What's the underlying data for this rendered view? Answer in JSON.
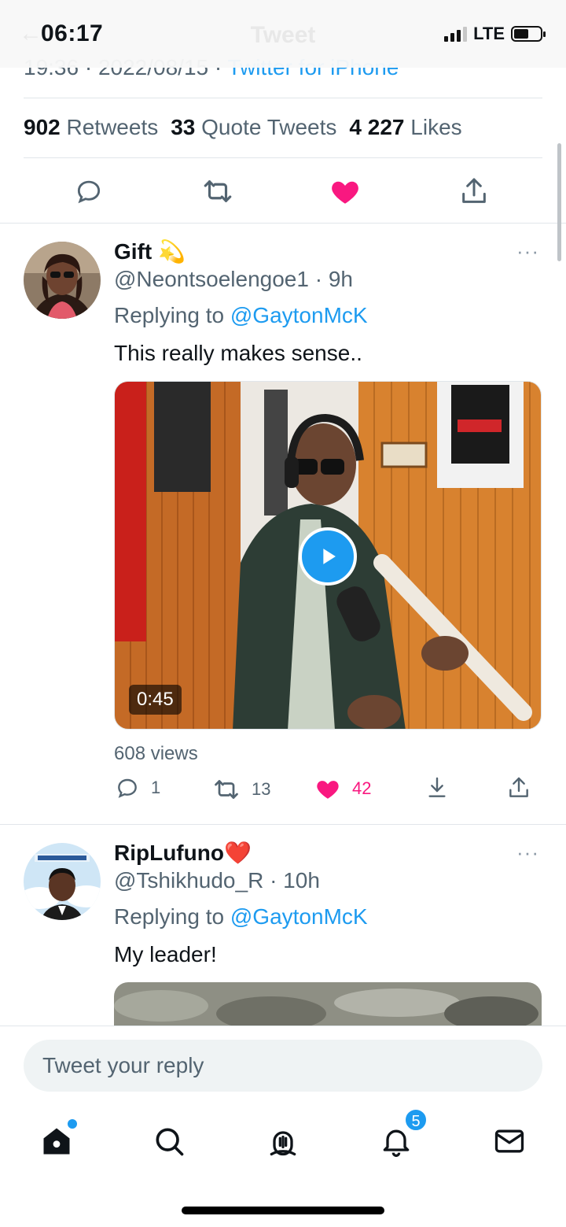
{
  "status_bar": {
    "time": "06:17",
    "network": "LTE",
    "header_title": "Tweet"
  },
  "tweet_meta": {
    "time_date": "19:36 · 2022/08/15 · ",
    "source": "Twitter for iPhone"
  },
  "stats": [
    {
      "count": "902",
      "label": "Retweets"
    },
    {
      "count": "33",
      "label": "Quote Tweets"
    },
    {
      "count": "4 227",
      "label": "Likes"
    }
  ],
  "main_actions": [
    "reply-icon",
    "retweet-icon",
    "like-icon",
    "share-icon"
  ],
  "replies": [
    {
      "name": "Gift 💫",
      "handle_time": "@Neontsoelengoe1 · 9h",
      "replying_prefix": "Replying to ",
      "replying_to": "@GaytonMcK",
      "text": "This really makes sense..",
      "video_duration": "0:45",
      "views": "608 views",
      "reply_count": "1",
      "retweet_count": "13",
      "like_count": "42",
      "more": "···"
    },
    {
      "name": "RipLufuno❤️",
      "handle_time": "@Tshikhudo_R · 10h",
      "replying_prefix": "Replying to ",
      "replying_to": "@GaytonMcK",
      "text": "My leader!",
      "more": "···"
    }
  ],
  "reply_box": {
    "placeholder": "Tweet your reply"
  },
  "tab_bar": {
    "notifications_badge": "5"
  },
  "colors": {
    "accent": "#1d9bf0",
    "like": "#f91880",
    "muted": "#536471"
  }
}
